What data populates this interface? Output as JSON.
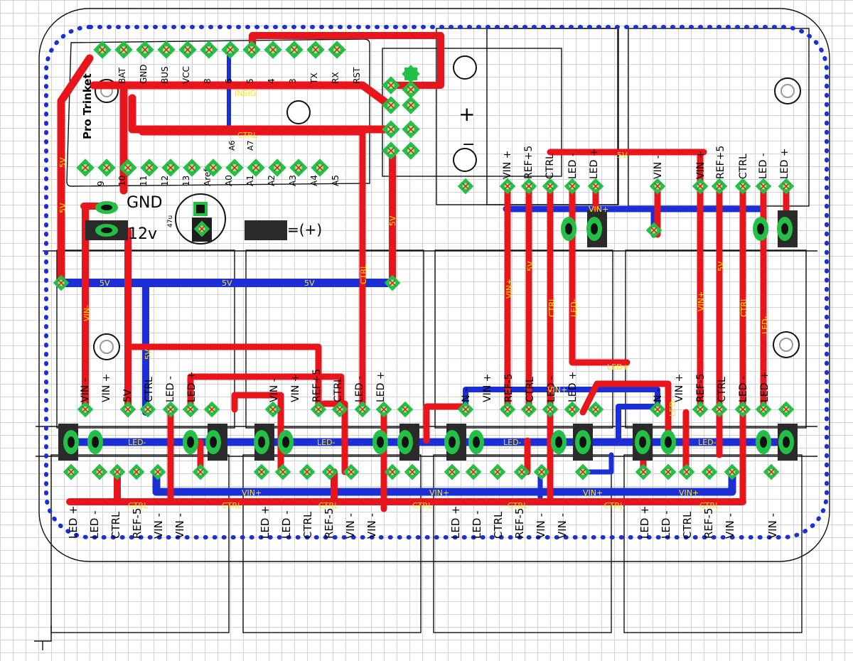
{
  "board": {
    "module_title": "Pro Trinket",
    "header_pins": [
      "BAT",
      "GND",
      "BUS",
      "VCC",
      "8",
      "6",
      "5",
      "4",
      "3",
      "TX",
      "RX",
      "RST"
    ],
    "header_pins_bottom": [
      "9",
      "10",
      "11",
      "12",
      "13",
      "Aref",
      "A0",
      "A1",
      "A2",
      "A3",
      "A4",
      "A5"
    ],
    "extra_labels": [
      "A6",
      "A7"
    ],
    "gnd_label": "GND",
    "twelve_v_label": "12v",
    "cap_label": "47u",
    "plus_label": "=(+)"
  },
  "trace_labels": {
    "insig": "INSIG",
    "ctrl": "CTRL",
    "five_v": "5V",
    "vin_plus": "VIN+",
    "vin_minus": "VIN-",
    "led_minus": "LED-",
    "led_plus": "LED+"
  },
  "top_driver_pins": [
    [
      "VIN +",
      "REF+5",
      "CTRL",
      "LED -",
      "LED +"
    ],
    [
      "VIN -",
      "VIN +",
      "REF+5",
      "CTRL",
      "LED -",
      "LED +"
    ]
  ],
  "middle_driver_pins": [
    [
      "VIN -",
      "VIN +",
      "5V",
      "CTRL",
      "LED -",
      "LED +"
    ],
    [
      "VIN -",
      "VIN +",
      "REF+5",
      "CTRL",
      "LED -",
      "LED +"
    ],
    [
      "N -",
      "VIN +",
      "REF-5",
      "CTRL",
      "LED -",
      "LED +"
    ],
    [
      "N -",
      "VIN +",
      "REF-5",
      "CTRL",
      "LED -",
      "LED +"
    ]
  ],
  "bottom_pins": [
    "LED +",
    "LED -",
    "CTRL",
    "REF-5",
    "VIN -",
    "VIN -"
  ],
  "bottom_pins_last": [
    "LED +",
    "LED -",
    "CTRL",
    "REF-5",
    "VIN -",
    "",
    "VIN -"
  ],
  "colors": {
    "top_copper": "#e8161c",
    "bottom_copper": "#1c2fd6",
    "pad": "#22c046",
    "pad_center": "#8ef08e",
    "via_mark": "#e8161c",
    "label_text": "#ffea00"
  }
}
